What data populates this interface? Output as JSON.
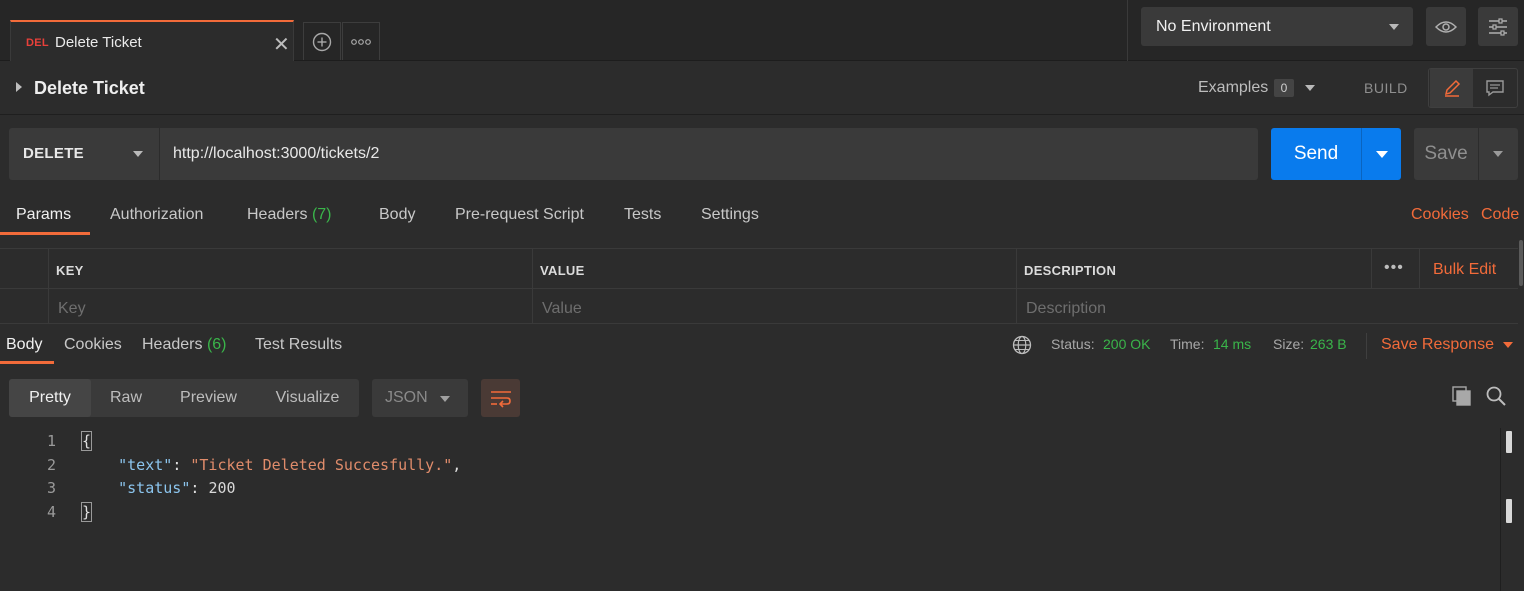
{
  "tab": {
    "method": "DEL",
    "name": "Delete Ticket"
  },
  "environment": {
    "selected": "No Environment"
  },
  "title_bar": {
    "title": "Delete Ticket",
    "examples_label": "Examples",
    "examples_count": "0",
    "build_label": "BUILD"
  },
  "request": {
    "method": "DELETE",
    "url": "http://localhost:3000/tickets/2",
    "send_label": "Send",
    "save_label": "Save"
  },
  "request_tabs": {
    "params": "Params",
    "authorization": "Authorization",
    "headers": "Headers",
    "headers_count": "(7)",
    "body": "Body",
    "prerequest": "Pre-request Script",
    "tests": "Tests",
    "settings": "Settings",
    "cookies_link": "Cookies",
    "code_link": "Code"
  },
  "params_table": {
    "col_key": "KEY",
    "col_value": "VALUE",
    "col_description": "DESCRIPTION",
    "bulk_edit": "Bulk Edit",
    "key_placeholder": "Key",
    "value_placeholder": "Value",
    "description_placeholder": "Description"
  },
  "response_tabs": {
    "body": "Body",
    "cookies": "Cookies",
    "headers": "Headers",
    "headers_count": "(6)",
    "test_results": "Test Results"
  },
  "response_meta": {
    "status_label": "Status:",
    "status_value": "200 OK",
    "time_label": "Time:",
    "time_value": "14 ms",
    "size_label": "Size:",
    "size_value": "263 B",
    "save_response": "Save Response"
  },
  "body_toolbar": {
    "pretty": "Pretty",
    "raw": "Raw",
    "preview": "Preview",
    "visualize": "Visualize",
    "language": "JSON"
  },
  "response_body": {
    "line_numbers": [
      "1",
      "2",
      "3",
      "4"
    ],
    "open_brace": "{",
    "close_brace": "}",
    "key_text": "\"text\"",
    "value_text": "\"Ticket Deleted Succesfully.\"",
    "key_status": "\"status\"",
    "value_status": "200"
  },
  "colors": {
    "accent": "#f26b3a",
    "send_blue": "#097bed",
    "success_green": "#3ab54a",
    "method_delete": "#e8403a"
  },
  "icons": [
    "close-icon",
    "plus-circle-icon",
    "more-horizontal-icon",
    "eye-icon",
    "sliders-icon",
    "pencil-icon",
    "comment-icon",
    "globe-icon",
    "wrap-lines-icon",
    "copy-icon",
    "search-icon"
  ]
}
